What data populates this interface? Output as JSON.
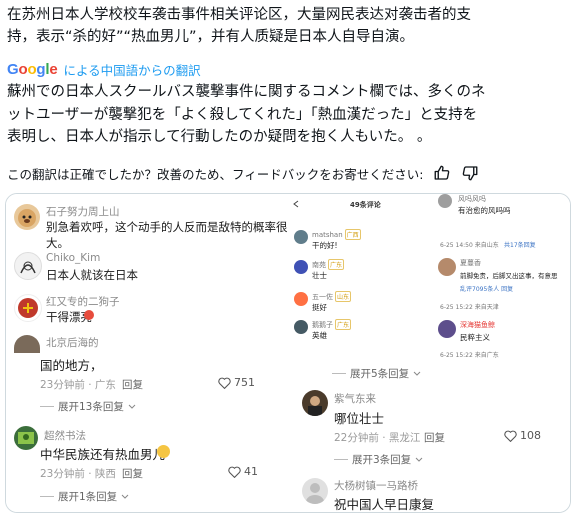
{
  "original": {
    "line1": "在苏州日本人学校校车袭击事件相关评论区，大量网民表达对袭击者的支",
    "line2": "持，表示“杀的好”“热血男儿”，并有人质疑是日本人自导自演。"
  },
  "translation_bar": {
    "logo": "Google",
    "label": "による中国語からの翻訳"
  },
  "translated": {
    "line1": "蘇州での日本人スクールバス襲撃事件に関するコメント欄では、多くのネ",
    "line2": "ットユーザーが襲撃犯を「よく殺してくれた」「熱血漢だった」と支持を",
    "line3": "表明し、日本人が指示して行動したのか疑問を抱く人もいた。 。"
  },
  "feedback": {
    "question": "この翻訳は正確でしたか？改善のため、フィードバックをお寄せください:",
    "thumbs_up_icon": "thumbs-up-icon",
    "thumbs_down_icon": "thumbs-down-icon"
  },
  "left_comments": [
    {
      "user": "石子努力周上山",
      "text": "别急着欢呼，这个动手的人反而是敌特的概率很大。"
    },
    {
      "user": "Chiko_Kim",
      "text": "日本人就该在日本"
    },
    {
      "user": "红又专的二狗子",
      "text": "干得漂亮"
    },
    {
      "user": "北京后海的",
      "text": "国的地方，",
      "time": "23分钟前 · 广东",
      "reply": "回复",
      "likes": "751"
    },
    {
      "expand": "展开13条回复"
    },
    {
      "user": "超然书法",
      "text": "中华民族还有热血男儿",
      "time": "23分钟前 · 陕西",
      "reply": "回复",
      "likes": "41"
    },
    {
      "expand": "展开1条回复"
    }
  ],
  "right_top": {
    "header": "49条评论",
    "items": [
      {
        "user": "matshan",
        "tag": "广西",
        "text": "干的好!"
      },
      {
        "user": "南苑",
        "tag": "广东",
        "text": "壮士"
      },
      {
        "user": "五一佐",
        "tag": "山东",
        "text": "挺好"
      },
      {
        "user": "鹅鹅子",
        "tag": "广东",
        "text": "英雄"
      }
    ],
    "side_items": [
      {
        "user": "风吗风吗",
        "text": "有治愈的风吗吗",
        "meta": "6-25 14:50 来自山东",
        "reply": "共17条回复"
      },
      {
        "user": "夏蔓香",
        "text": "前脚免责，后脚又出这事，有意思",
        "meta": "6-25 15:22 来自天津",
        "reply": "乱评7095条人 回复"
      },
      {
        "user": "深海猫鱼鲸",
        "text": "民粹主义",
        "meta": "6-25 15:22 来自广东"
      }
    ]
  },
  "right_comments": [
    {
      "expand": "展开5条回复"
    },
    {
      "user": "紫气东来",
      "text": "哪位壮士",
      "time": "22分钟前 · 黑龙江",
      "reply": "回复",
      "likes": "108"
    },
    {
      "expand": "展开3条回复"
    },
    {
      "user": "大杨树镇一马路桥",
      "text": "祝中国人早日康复"
    }
  ]
}
